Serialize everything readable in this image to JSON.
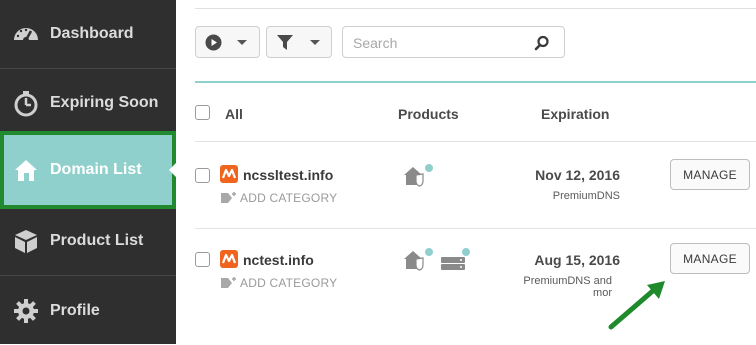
{
  "sidebar": {
    "items": [
      {
        "label": "Dashboard",
        "icon": "dashboard-gauge-icon"
      },
      {
        "label": "Expiring Soon",
        "icon": "stopwatch-icon"
      },
      {
        "label": "Domain List",
        "icon": "home-icon",
        "active": true
      },
      {
        "label": "Product List",
        "icon": "box-icon"
      },
      {
        "label": "Profile",
        "icon": "gear-icon"
      }
    ]
  },
  "toolbar": {
    "play_icon": "play-circle-icon",
    "filter_icon": "filter-funnel-icon",
    "search_placeholder": "Search",
    "search_icon": "magnifier-icon"
  },
  "table": {
    "headers": {
      "all": "All",
      "products": "Products",
      "expiration": "Expiration"
    },
    "rows": [
      {
        "domain": "ncssltest.info",
        "add_category": "ADD CATEGORY",
        "date": "Nov 12, 2016",
        "sub": "PremiumDNS",
        "button": "MANAGE"
      },
      {
        "domain": "nctest.info",
        "add_category": "ADD CATEGORY",
        "date": "Aug 15, 2016",
        "sub_line1": "PremiumDNS and",
        "sub_line2": "mor",
        "button": "MANAGE"
      }
    ]
  },
  "colors": {
    "sidebar_bg": "#2f2f2f",
    "active_bg": "#8fd0cd",
    "active_border": "#218a2e",
    "accent_teal": "#8fd0cd",
    "brand_orange": "#f0641e",
    "annotation_arrow": "#1f8a2b"
  }
}
